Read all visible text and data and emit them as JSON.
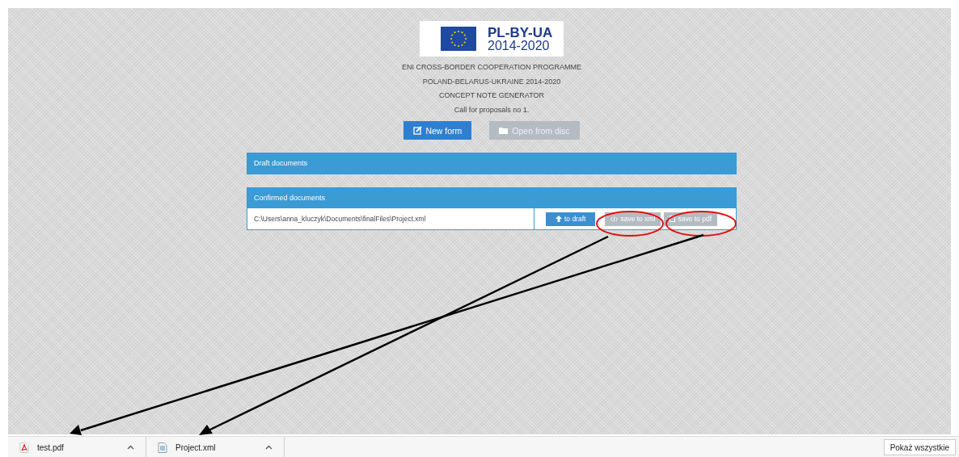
{
  "logo": {
    "title": "PL-BY-UA",
    "years": "2014-2020"
  },
  "header_lines": [
    "ENI CROSS-BORDER COOPERATION PROGRAMME",
    "POLAND-BELARUS-UKRAINE 2014-2020",
    "CONCEPT NOTE GENERATOR",
    "Call for proposals no 1."
  ],
  "buttons": [
    {
      "label": "New form",
      "kind": "edit",
      "disabled": false
    },
    {
      "label": "Open from disc",
      "kind": "folder",
      "disabled": true
    }
  ],
  "panels": [
    {
      "title": "Draft documents"
    },
    {
      "title": "Confirmed documents",
      "rows": [
        {
          "path": "C:\\Users\\anna_kluczyk\\Documents\\finalFiles\\Project.xml",
          "actions": [
            {
              "label": "to draft",
              "kind": "up",
              "disabled": false
            },
            {
              "label": "save to xml",
              "kind": "code",
              "disabled": true
            },
            {
              "label": "save to pdf",
              "kind": "file",
              "disabled": true
            }
          ]
        }
      ]
    }
  ],
  "downloads": [
    {
      "name": "test.pdf",
      "kind": "pdf"
    },
    {
      "name": "Project.xml",
      "kind": "xml"
    }
  ],
  "show_all": "Pokaż wszystkie"
}
